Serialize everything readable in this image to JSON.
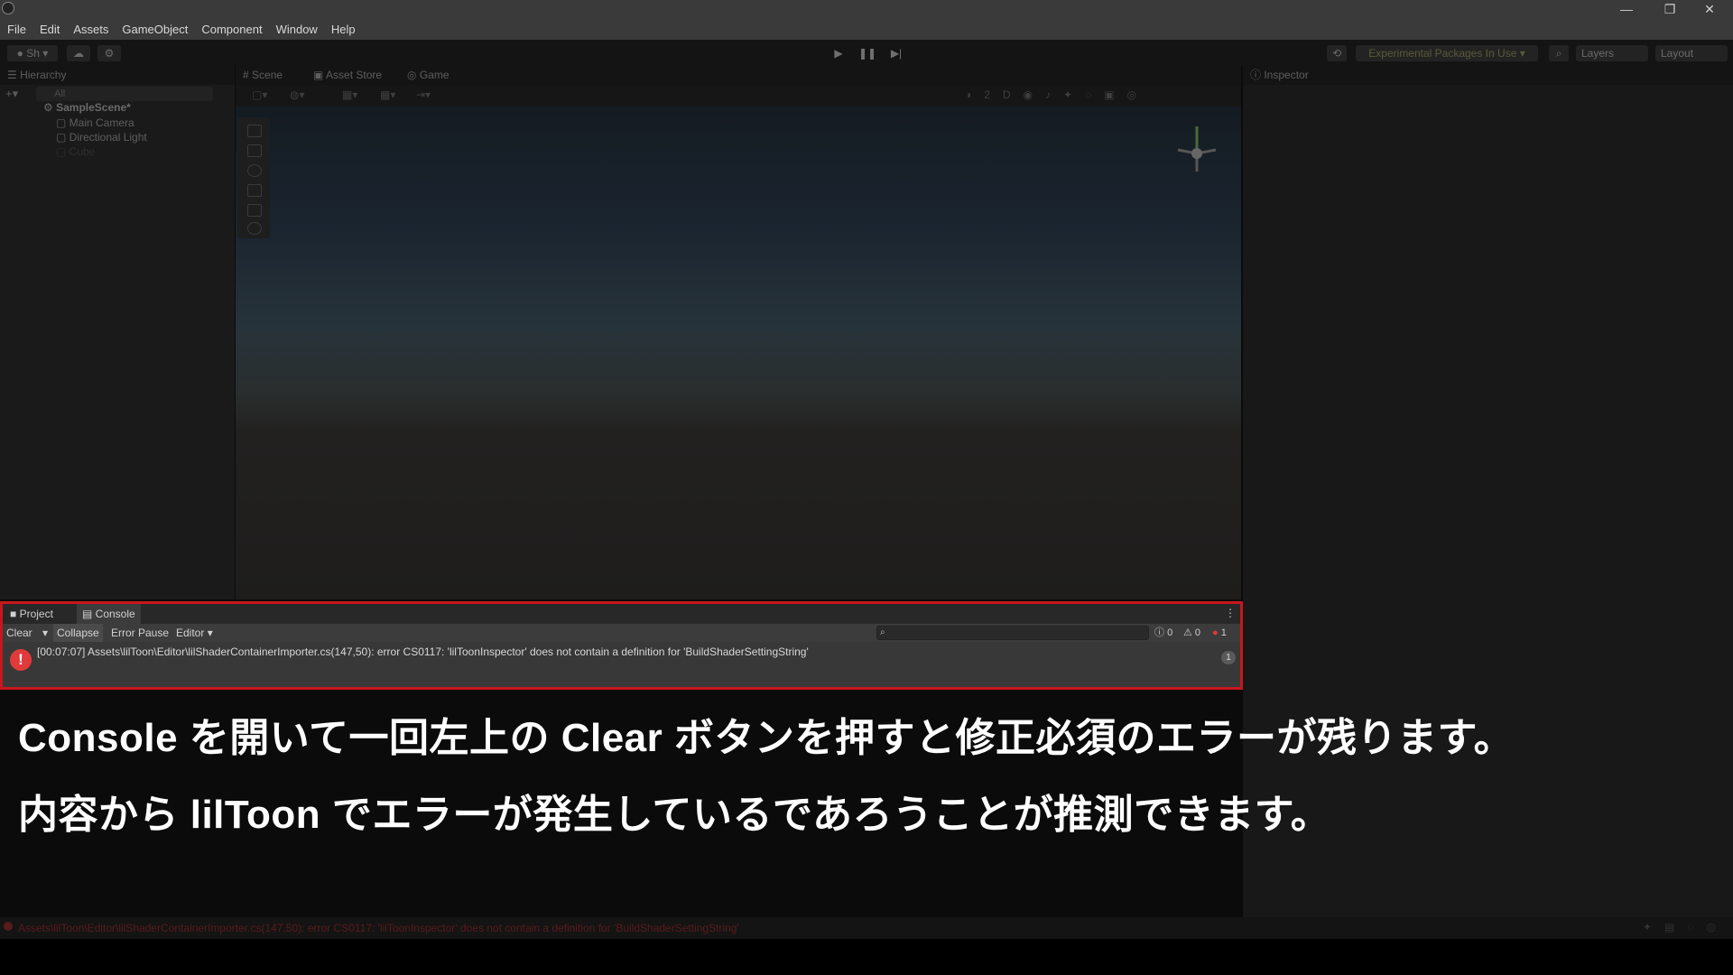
{
  "window": {
    "menu": [
      "File",
      "Edit",
      "Assets",
      "GameObject",
      "Component",
      "Window",
      "Help"
    ],
    "controls": {
      "minimize": "—",
      "restore": "❐",
      "close": "✕"
    }
  },
  "toolbar": {
    "account_label": "Sh",
    "packages_label": "Experimental Packages In Use ▾",
    "layers_label": "Layers",
    "layout_label": "Layout"
  },
  "hierarchy": {
    "tab_label": "Hierarchy",
    "search_placeholder": "All",
    "scene_name": "SampleScene*",
    "items": [
      "Main Camera",
      "Directional Light",
      "Cube"
    ]
  },
  "scene_tabs": [
    "Scene",
    "Asset Store",
    "Game"
  ],
  "inspector": {
    "tab_label": "Inspector"
  },
  "console_panel": {
    "tabs": [
      "Project",
      "Console"
    ],
    "buttons": {
      "clear": "Clear",
      "collapse": "Collapse",
      "error_pause": "Error Pause",
      "editor": "Editor"
    },
    "counts": {
      "info": "0",
      "warning": "0",
      "error": "1"
    },
    "log": {
      "message": "[00:07:07] Assets\\lilToon\\Editor\\lilShaderContainerImporter.cs(147,50): error CS0117: 'lilToonInspector' does not contain a definition for 'BuildShaderSettingString'",
      "count": "1",
      "color": "#e03a3a"
    },
    "highlight_color": "#c8161d"
  },
  "captions": {
    "line1": "Console を開いて一回左上の Clear ボタンを押すと修正必須のエラーが残ります。",
    "line2": "内容から lilToon でエラーが発生しているであろうことが推測できます。"
  },
  "status_bar": {
    "message": "Assets\\lilToon\\Editor\\lilShaderContainerImporter.cs(147,50): error CS0117: 'lilToonInspector' does not contain a definition for 'BuildShaderSettingString'"
  }
}
